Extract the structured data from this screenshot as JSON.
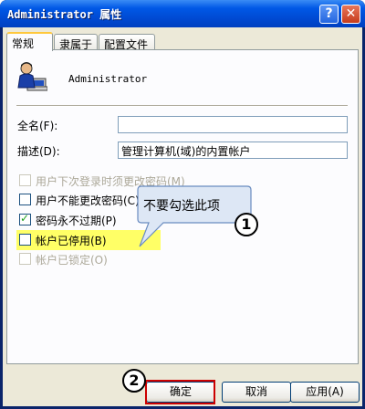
{
  "window": {
    "title": "Administrator 属性",
    "help_glyph": "?",
    "close_glyph": "✕"
  },
  "tabs": [
    {
      "label": "常规",
      "active": true
    },
    {
      "label": "隶属于",
      "active": false
    },
    {
      "label": "配置文件",
      "active": false
    }
  ],
  "user": {
    "icon": "user-account-icon",
    "name": "Administrator"
  },
  "form": {
    "fullname": {
      "label": "全名(F):",
      "value": ""
    },
    "description": {
      "label": "描述(D):",
      "value": "管理计算机(域)的内置帐户"
    }
  },
  "checkboxes": [
    {
      "label": "用户下次登录时须更改密码(M)",
      "checked": false,
      "enabled": false
    },
    {
      "label": "用户不能更改密码(C)",
      "checked": false,
      "enabled": true
    },
    {
      "label": "密码永不过期(P)",
      "checked": true,
      "enabled": true
    },
    {
      "label": "帐户已停用(B)",
      "checked": false,
      "enabled": true
    },
    {
      "label": "帐户已锁定(O)",
      "checked": false,
      "enabled": false
    }
  ],
  "annotation": {
    "callout_text": "不要勾选此项",
    "marker_1": "1",
    "marker_2": "2",
    "highlight_color": "#ffff66",
    "marker_color": "#cc0000"
  },
  "buttons": {
    "ok": "确定",
    "cancel": "取消",
    "apply": "应用(A)"
  },
  "colors": {
    "titlebar": "#0054e3",
    "dialog_bg": "#ece9d8",
    "tab_highlight": "#ffc83c"
  }
}
